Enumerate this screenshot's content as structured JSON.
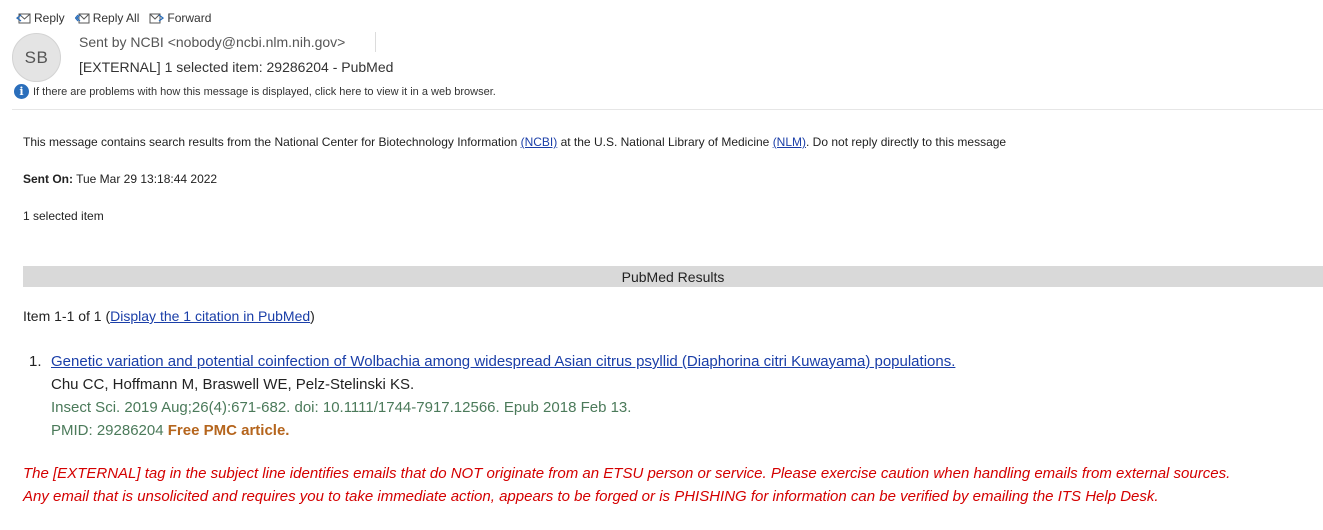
{
  "toolbar": {
    "reply": "Reply",
    "reply_all": "Reply All",
    "forward": "Forward"
  },
  "header": {
    "avatar_initials": "SB",
    "sender": "Sent by NCBI <nobody@ncbi.nlm.nih.gov>",
    "subject": "[EXTERNAL] 1 selected item: 29286204 - PubMed",
    "info_text": "If there are problems with how this message is displayed, click here to view it in a web browser."
  },
  "message": {
    "intro_prefix": "This message contains search results from the National Center for Biotechnology Information ",
    "ncbi_link": "(NCBI)",
    "intro_mid": " at the U.S. National Library of Medicine ",
    "nlm_link": "(NLM)",
    "intro_suffix": ". Do not reply directly to this message",
    "sent_on_label": "Sent On:",
    "sent_on_value": " Tue Mar 29 13:18:44 2022",
    "selected_count": "1 selected item",
    "results_heading": "PubMed Results",
    "item_range": "Item 1-1 of 1 (",
    "display_link": "Display the 1 citation in PubMed",
    "item_range_close": ")"
  },
  "citation": {
    "number": "1.",
    "title": "Genetic variation and potential coinfection of Wolbachia among widespread Asian citrus psyllid (Diaphorina citri Kuwayama) populations.",
    "authors": "Chu CC, Hoffmann M, Braswell WE, Pelz-Stelinski KS.",
    "source": "Insect Sci. 2019 Aug;26(4):671-682. doi: 10.1111/1744-7917.12566. Epub 2018 Feb 13.",
    "pmid": "PMID: 29286204 ",
    "free_pmc": "Free PMC article."
  },
  "warning": {
    "line1": "The [EXTERNAL] tag in the subject line identifies emails that do NOT originate from an ETSU person or service. Please exercise caution when handling emails from external sources.",
    "line2": "Any email that is unsolicited and requires you to take immediate action, appears to be forged or is PHISHING for information can be verified by emailing the ITS Help Desk."
  },
  "icons": {
    "reply": "reply-icon",
    "reply_all": "reply-all-icon",
    "forward": "forward-icon",
    "info": "info-icon"
  },
  "colors": {
    "link": "#1a3ea8",
    "warning": "#d40000",
    "citation_source": "#4b7a5a",
    "free_pmc": "#b5651d",
    "results_bar": "#d9d9d9"
  }
}
